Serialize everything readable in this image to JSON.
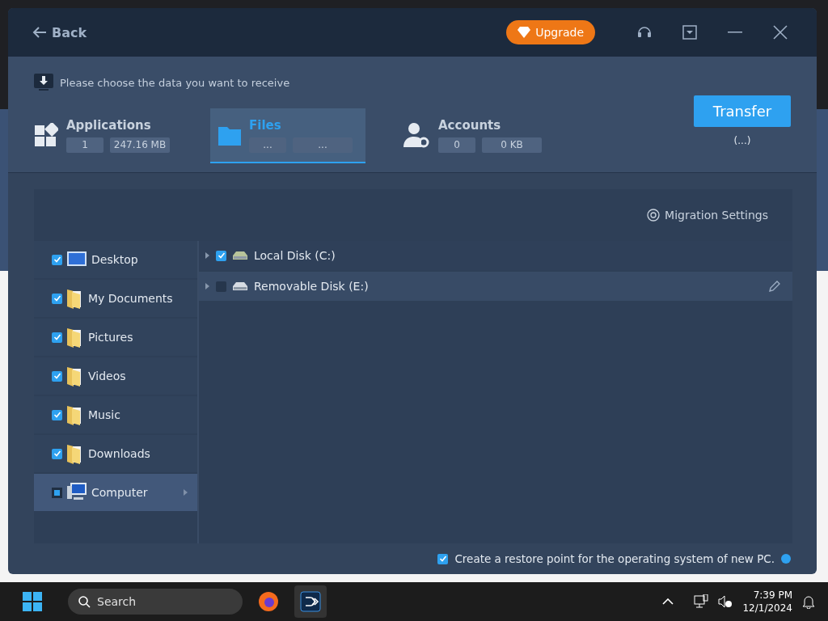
{
  "header": {
    "back": "Back",
    "upgrade": "Upgrade"
  },
  "prompt": "Please choose the data you want to receive",
  "categories": [
    {
      "kind": "applications",
      "label": "Applications",
      "count": "1",
      "size": "247.16 MB",
      "selected": false
    },
    {
      "kind": "files",
      "label": "Files",
      "count": "...",
      "size": "...",
      "selected": true
    },
    {
      "kind": "accounts",
      "label": "Accounts",
      "count": "0",
      "size": "0 KB",
      "selected": false
    }
  ],
  "transfer": {
    "label": "Transfer",
    "status": "(...)"
  },
  "migration_settings": "Migration Settings",
  "folders": [
    {
      "kind": "desktop",
      "label": "Desktop",
      "checked": true,
      "partial": false,
      "selected": false
    },
    {
      "kind": "folder",
      "label": "My Documents",
      "checked": true,
      "partial": false,
      "selected": false
    },
    {
      "kind": "folder",
      "label": "Pictures",
      "checked": true,
      "partial": false,
      "selected": false
    },
    {
      "kind": "folder",
      "label": "Videos",
      "checked": true,
      "partial": false,
      "selected": false
    },
    {
      "kind": "folder",
      "label": "Music",
      "checked": true,
      "partial": false,
      "selected": false
    },
    {
      "kind": "folder",
      "label": "Downloads",
      "checked": true,
      "partial": false,
      "selected": false
    },
    {
      "kind": "computer",
      "label": "Computer",
      "checked": false,
      "partial": true,
      "selected": true
    }
  ],
  "drives": [
    {
      "label": "Local Disk (C:)",
      "checked": true,
      "selected": false
    },
    {
      "label": "Removable Disk (E:)",
      "checked": false,
      "selected": true
    }
  ],
  "restore_point": {
    "label": "Create a restore point for the operating system of new PC.",
    "checked": true
  },
  "taskbar": {
    "search_placeholder": "Search",
    "time": "7:39 PM",
    "date": "12/1/2024"
  }
}
